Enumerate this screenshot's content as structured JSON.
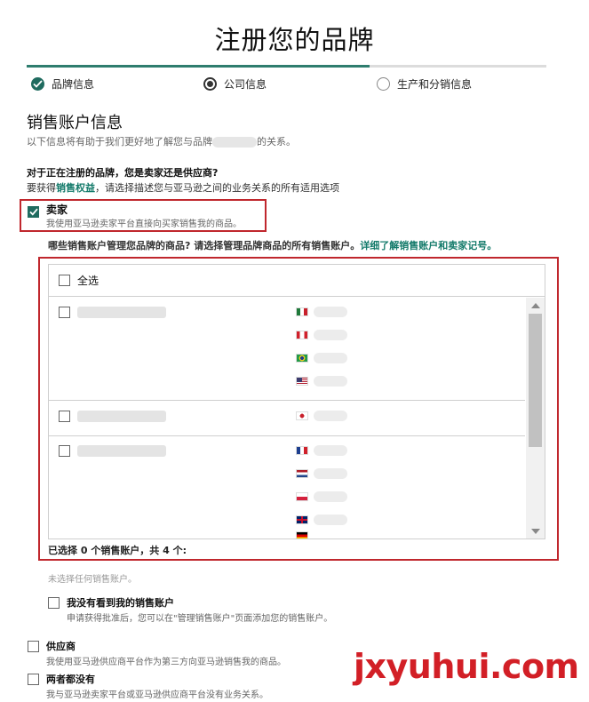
{
  "page": {
    "title": "注册您的品牌"
  },
  "steps": [
    {
      "label": "品牌信息",
      "state": "done"
    },
    {
      "label": "公司信息",
      "state": "active"
    },
    {
      "label": "生产和分销信息",
      "state": "todo"
    }
  ],
  "progress": {
    "completed_fraction": 0.66
  },
  "section": {
    "title": "销售账户信息",
    "subtitle_before": "以下信息将有助于我们更好地了解您与品牌",
    "subtitle_after": "的关系。"
  },
  "question": {
    "title": "对于正在注册的品牌，您是卖家还是供应商?",
    "prefix": "要获得",
    "link": "销售权益",
    "suffix": "，请选择描述您与亚马逊之间的业务关系的所有适用选项"
  },
  "seller": {
    "label": "卖家",
    "desc": "我使用亚马逊卖家平台直接向买家销售我的商品。",
    "checked": true
  },
  "accounts": {
    "question": "哪些销售账户管理您品牌的商品? 请选择管理品牌商品的所有销售账户。",
    "link": "详细了解销售账户和卖家记号。",
    "select_all": "全选",
    "groups": [
      {
        "flags": [
          "mx",
          "ca",
          "br",
          "us"
        ]
      },
      {
        "flags": [
          "jp"
        ]
      },
      {
        "flags": [
          "fr",
          "nl",
          "pl",
          "gb",
          "de"
        ]
      }
    ],
    "count_text": "已选择 0 个销售账户，共 4 个:",
    "none_selected": "未选择任何销售账户。",
    "not_seen_label": "我没有看到我的销售账户",
    "not_seen_desc": "申请获得批准后，您可以在\"管理销售账户\"页面添加您的销售账户。"
  },
  "vendor": {
    "label": "供应商",
    "desc": "我使用亚马逊供应商平台作为第三方向亚马逊销售我的商品。"
  },
  "neither": {
    "label": "两者都没有",
    "desc": "我与亚马逊卖家平台或亚马逊供应商平台没有业务关系。"
  },
  "watermark": "jxyuhui.com",
  "colors": {
    "accent": "#1f6b5f",
    "link": "#137a6a",
    "highlight_border": "#c0272d",
    "watermark": "#d21f26"
  }
}
